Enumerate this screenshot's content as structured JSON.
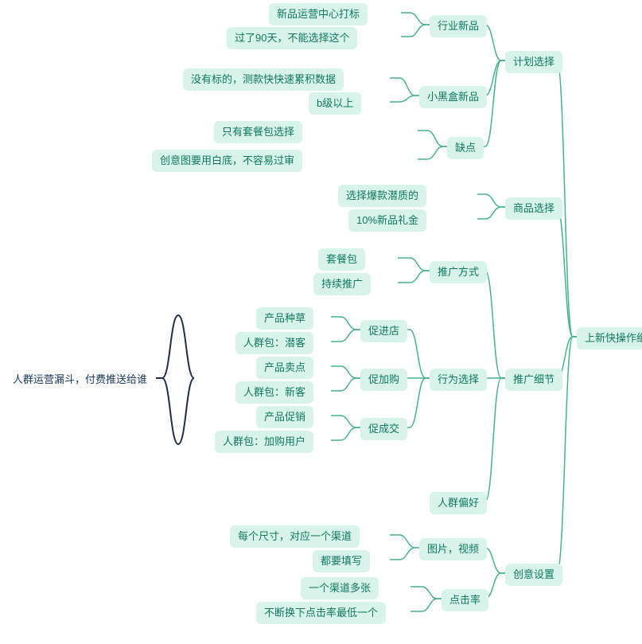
{
  "root": {
    "text": "上新快操作细节"
  },
  "plan": {
    "text": "计划选择"
  },
  "plan_ind": {
    "text": "行业新品"
  },
  "plan_ind_tag": {
    "text": "新品运营中心打标"
  },
  "plan_ind_90": {
    "text": "过了90天，不能选择这个"
  },
  "plan_box": {
    "text": "小黑盒新品"
  },
  "plan_box_notag": {
    "text": "没有标的，测款快快速累积数据"
  },
  "plan_box_b": {
    "text": "b级以上"
  },
  "plan_con": {
    "text": "缺点"
  },
  "plan_con_pkg": {
    "text": "只有套餐包选择"
  },
  "plan_con_white": {
    "text": "创意图要用白底，不容易过审"
  },
  "goods": {
    "text": "商品选择"
  },
  "goods_hot": {
    "text": "选择爆款潜质的"
  },
  "goods_10": {
    "text": "10%新品礼金"
  },
  "detail": {
    "text": "推广细节"
  },
  "detail_way": {
    "text": "推广方式"
  },
  "detail_way_pkg": {
    "text": "套餐包"
  },
  "detail_way_cont": {
    "text": "持续推广"
  },
  "detail_beh": {
    "text": "行为选择"
  },
  "detail_beh_shop": {
    "text": "促进店"
  },
  "detail_beh_shop_seed": {
    "text": "产品种草"
  },
  "detail_beh_shop_pkg": {
    "text": "人群包：潜客"
  },
  "detail_beh_cart": {
    "text": "促加购"
  },
  "detail_beh_cart_sell": {
    "text": "产品卖点"
  },
  "detail_beh_cart_pkg": {
    "text": "人群包：新客"
  },
  "detail_beh_deal": {
    "text": "促成交"
  },
  "detail_beh_deal_promo": {
    "text": "产品促销"
  },
  "detail_beh_deal_pkg": {
    "text": "人群包：加购用户"
  },
  "detail_pref": {
    "text": "人群偏好"
  },
  "funnel": {
    "text": "人群运营漏斗，付费推送给谁"
  },
  "creative": {
    "text": "创意设置"
  },
  "creative_img": {
    "text": "图片，视频"
  },
  "creative_img_size": {
    "text": "每个尺寸，对应一个渠道"
  },
  "creative_img_fill": {
    "text": "都要填写"
  },
  "creative_ctr": {
    "text": "点击率"
  },
  "creative_ctr_multi": {
    "text": "一个渠道多张"
  },
  "creative_ctr_swap": {
    "text": "不断换下点击率最低一个"
  }
}
